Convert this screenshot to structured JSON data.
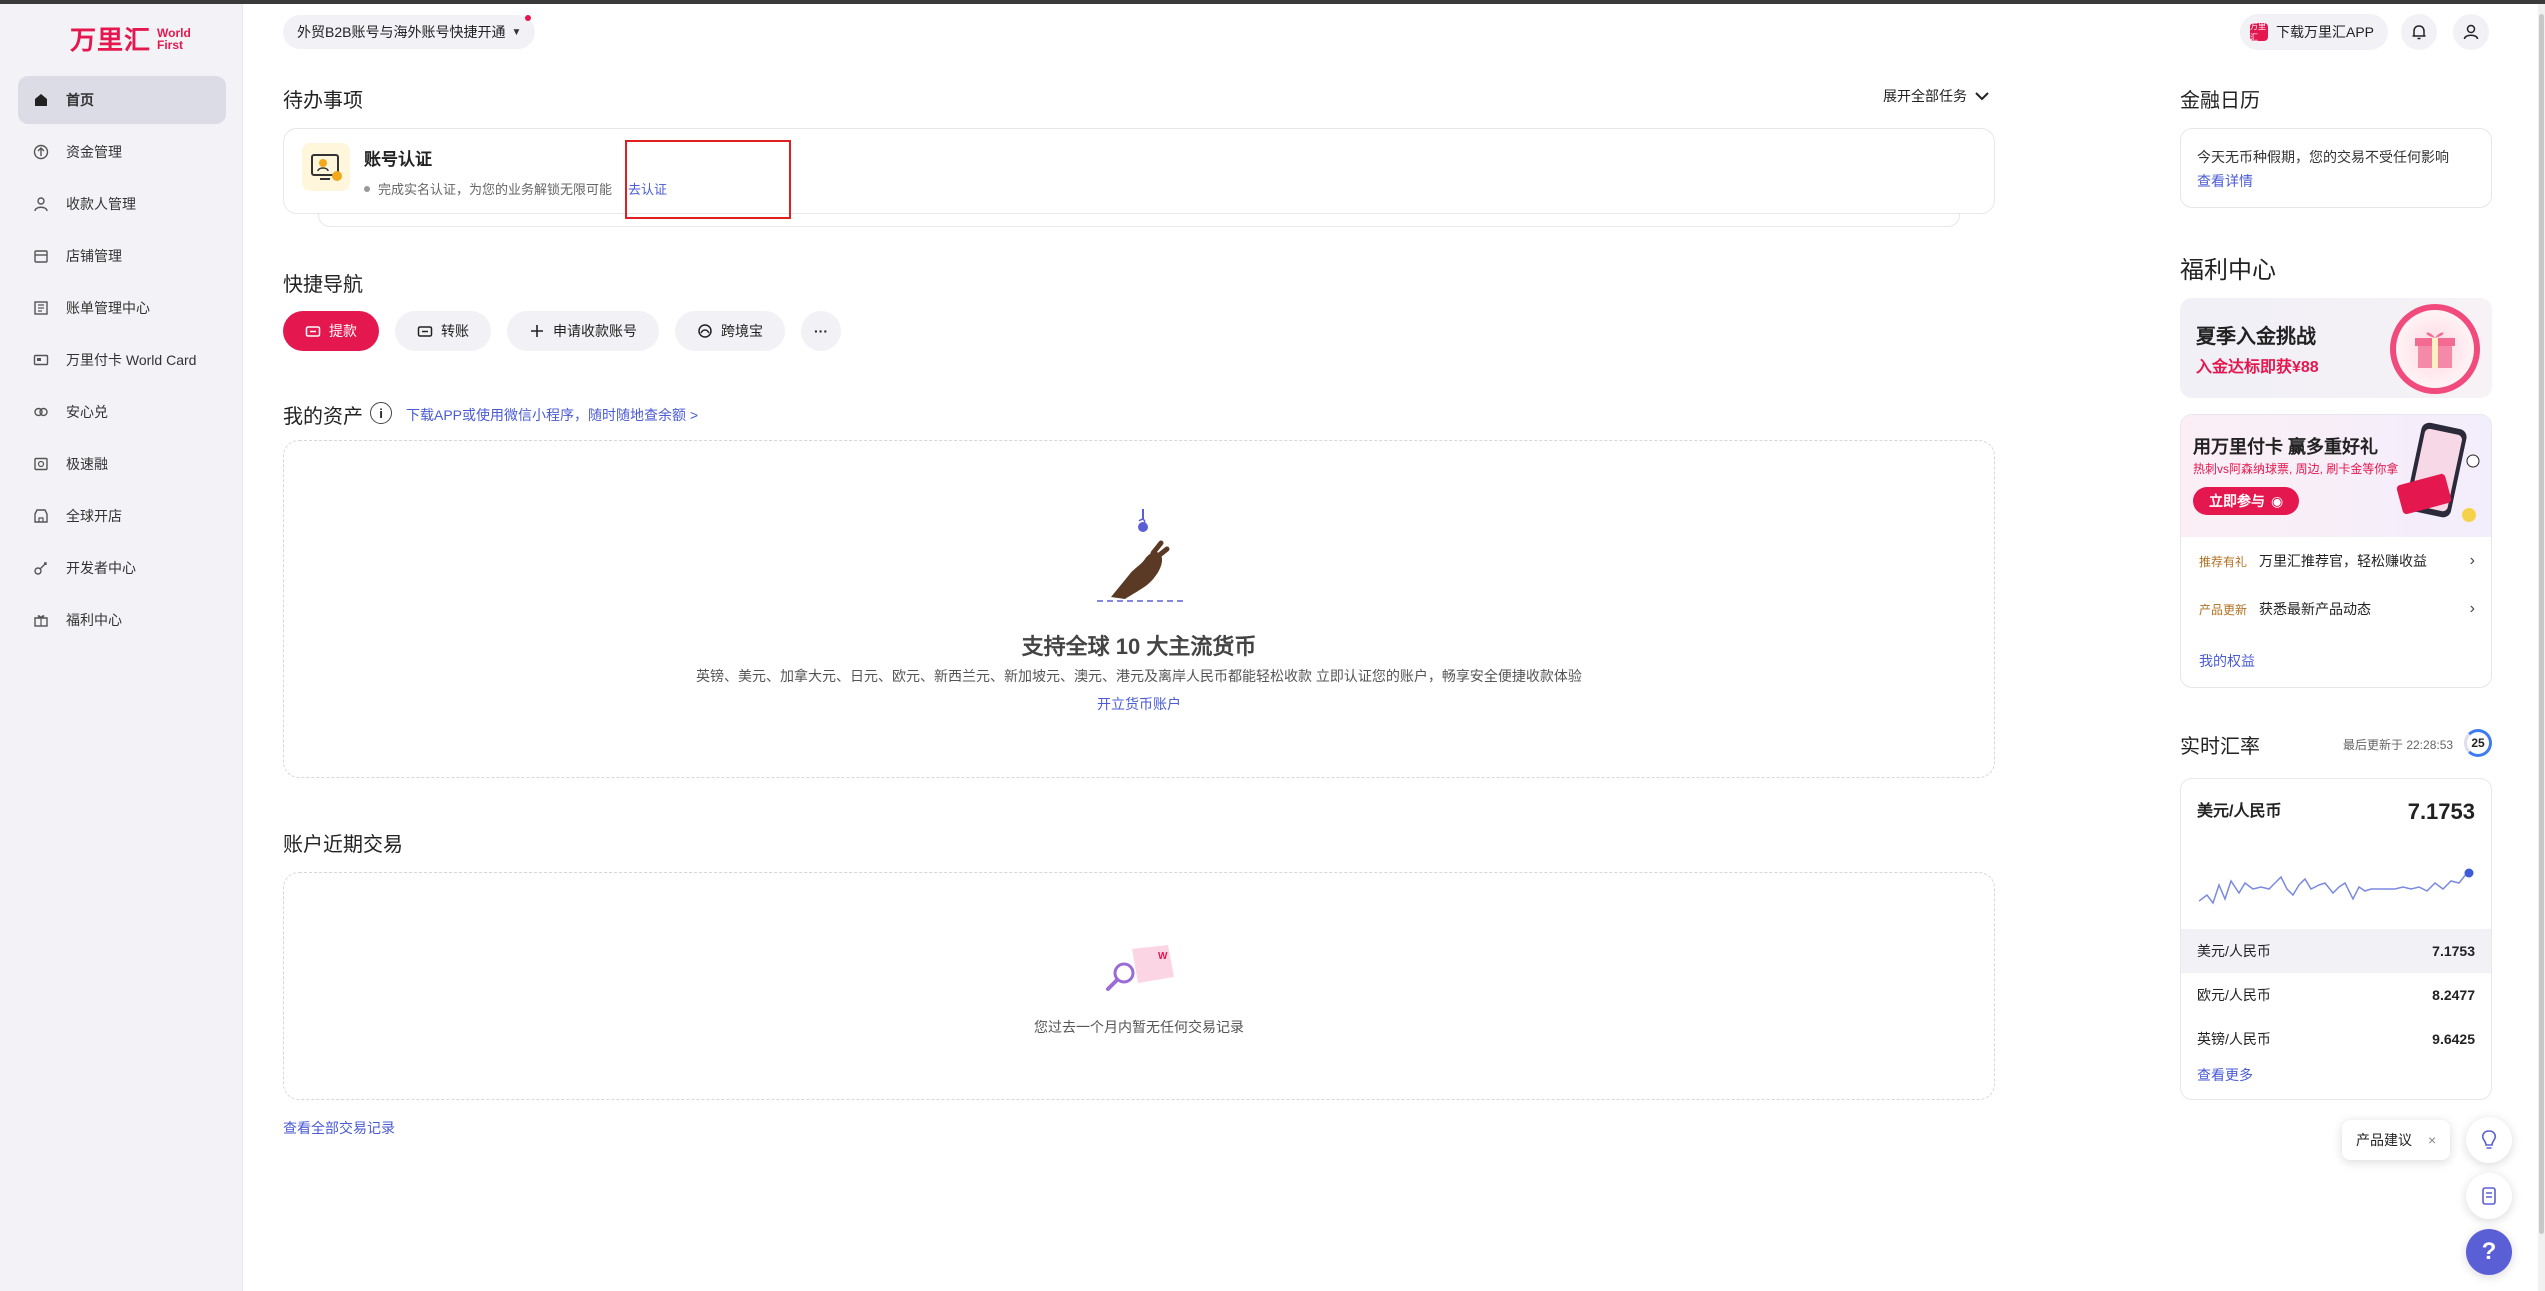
{
  "brand": {
    "name_cn": "万里汇",
    "name_en_1": "World",
    "name_en_2": "First",
    "accent": "#e4184f",
    "link": "#4a5bd4"
  },
  "sidebar": {
    "items": [
      {
        "label": "首页",
        "icon": "home-icon",
        "active": true
      },
      {
        "label": "资金管理",
        "icon": "funds-icon"
      },
      {
        "label": "收款人管理",
        "icon": "payee-icon"
      },
      {
        "label": "店铺管理",
        "icon": "store-icon"
      },
      {
        "label": "账单管理中心",
        "icon": "bill-icon"
      },
      {
        "label": "万里付卡 World Card",
        "icon": "card-icon"
      },
      {
        "label": "安心兑",
        "icon": "exchange-icon"
      },
      {
        "label": "极速融",
        "icon": "finance-icon"
      },
      {
        "label": "全球开店",
        "icon": "global-store-icon"
      },
      {
        "label": "开发者中心",
        "icon": "developer-icon"
      },
      {
        "label": "福利中心",
        "icon": "gift-icon"
      }
    ]
  },
  "header": {
    "chip_label": "外贸B2B账号与海外账号快捷开通",
    "download_app": "下载万里汇APP",
    "app_badge": "万里汇"
  },
  "todo": {
    "title": "待办事项",
    "expand": "展开全部任务",
    "item_title": "账号认证",
    "item_desc": "完成实名认证，为您的业务解锁无限可能",
    "item_link": "去认证"
  },
  "quick_nav": {
    "title": "快捷导航",
    "buttons": [
      {
        "label": "提款",
        "icon": "withdraw-icon"
      },
      {
        "label": "转账",
        "icon": "transfer-icon"
      },
      {
        "label": "申请收款账号",
        "icon": "plus-icon"
      },
      {
        "label": "跨境宝",
        "icon": "crossborder-icon"
      }
    ],
    "more": "···"
  },
  "assets": {
    "title": "我的资产",
    "info": "i",
    "hint": "下载APP或使用微信小程序，随时随地查余额 >",
    "empty_title": "支持全球 10 大主流货币",
    "empty_desc": "英镑、美元、加拿大元、日元、欧元、新西兰元、新加坡元、澳元、港元及离岸人民币都能轻松收款 立即认证您的账户，畅享安全便捷收款体验",
    "empty_link": "开立货币账户"
  },
  "transactions": {
    "title": "账户近期交易",
    "empty": "您过去一个月内暂无任何交易记录",
    "view_all": "查看全部交易记录"
  },
  "calendar": {
    "title": "金融日历",
    "text": "今天无币种假期，您的交易不受任何影响",
    "link": "查看详情"
  },
  "welfare": {
    "title": "福利中心",
    "promo1_title": "夏季入金挑战",
    "promo1_sub": "入金达标即获¥88",
    "promo2_title": "用万里付卡 赢多重好礼",
    "promo2_sub": "热刺vs阿森纳球票, 周边, 刷卡金等你拿",
    "promo2_btn": "立即参与",
    "rows": [
      {
        "tag": "推荐有礼",
        "text": "万里汇推荐官，轻松赚收益"
      },
      {
        "tag": "产品更新",
        "text": "获悉最新产品动态"
      }
    ],
    "my_rights": "我的权益"
  },
  "rates": {
    "title": "实时汇率",
    "updated": "最后更新于 22:28:53",
    "countdown": "25",
    "main_pair": "美元/人民币",
    "main_value": "7.1753",
    "rows": [
      {
        "pair": "美元/人民币",
        "value": "7.1753"
      },
      {
        "pair": "欧元/人民币",
        "value": "8.2477"
      },
      {
        "pair": "英镑/人民币",
        "value": "9.6425"
      }
    ],
    "more": "查看更多"
  },
  "floating": {
    "feedback": "产品建议",
    "close": "×",
    "help": "?"
  }
}
